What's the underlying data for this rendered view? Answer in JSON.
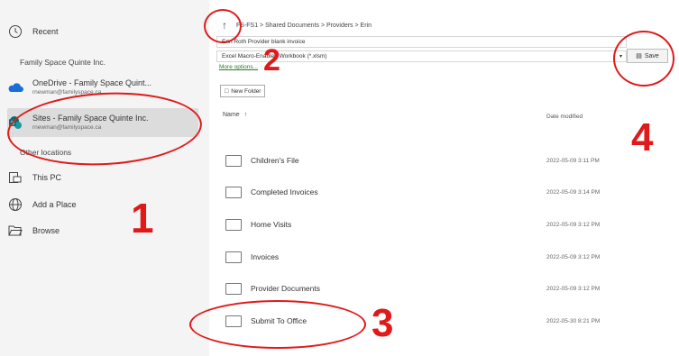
{
  "sidebar": {
    "recent": "Recent",
    "org_label": "Family Space Quinte Inc.",
    "onedrive": {
      "label": "OneDrive - Family Space Quint...",
      "email": "rnewman@familyspace.ca"
    },
    "sites": {
      "label": "Sites - Family Space Quinte Inc.",
      "email": "rnewman@familyspace.ca"
    },
    "other_locations": "Other locations",
    "this_pc": "This PC",
    "add_place": "Add a Place",
    "browse": "Browse"
  },
  "main": {
    "breadcrumb": "FS-FS1 > Shared Documents > Providers > Erin",
    "filename": "Erin Roth Provider blank invoice",
    "filetype": "Excel Macro-Enabled Workbook (*.xlsm)",
    "more_options": "More options...",
    "save_label": "Save",
    "new_folder": "New Folder",
    "col_name": "Name",
    "col_date": "Date modified",
    "folders": [
      {
        "name": "Children's File",
        "date": "2022-05-09 3:11 PM"
      },
      {
        "name": "Completed Invoices",
        "date": "2022-05-09 3:14 PM"
      },
      {
        "name": "Home Visits",
        "date": "2022-05-09 3:12 PM"
      },
      {
        "name": "Invoices",
        "date": "2022-05-09 3:12 PM"
      },
      {
        "name": "Provider Documents",
        "date": "2022-05-09 3:12 PM"
      },
      {
        "name": "Submit To Office",
        "date": "2022-05-30 8:21 PM"
      }
    ]
  },
  "annotations": {
    "n1": "1",
    "n2": "2",
    "n3": "3",
    "n4": "4",
    "color": "#e01a1a"
  }
}
